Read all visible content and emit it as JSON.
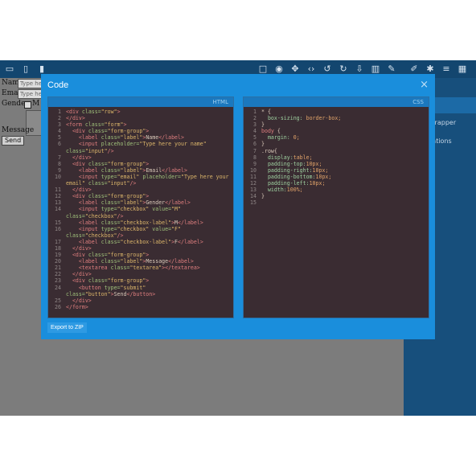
{
  "toolbar": {
    "left_icons": [
      "desktop-icon",
      "tablet-icon",
      "mobile-icon"
    ],
    "right_icons": [
      "square-icon",
      "eye-icon",
      "fullscreen-icon",
      "code-icon",
      "undo-icon",
      "redo-icon",
      "import-icon",
      "trash-icon",
      "edit-icon",
      "brush-icon",
      "gear-icon",
      "menu-icon",
      "grid-icon"
    ]
  },
  "canvas": {
    "name_label": "Name",
    "name_placeholder": "Type he",
    "email_label": "Email",
    "email_placeholder": "Type he",
    "gender_label": "Gender",
    "gender_m": "M",
    "message_label": "Message",
    "send_label": "Send"
  },
  "right_panel": {
    "items": [
      "wrapper",
      "rations"
    ]
  },
  "modal": {
    "title": "Code",
    "close": "×",
    "html_label": "HTML",
    "css_label": "CSS",
    "export_label": "Export to ZIP"
  }
}
